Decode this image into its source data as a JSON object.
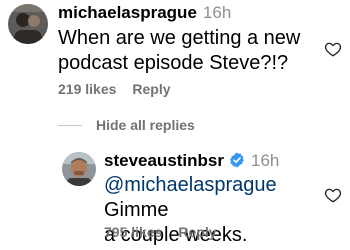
{
  "comment": {
    "username": "michaelasprague",
    "time": "16h",
    "text": "When are we getting a new podcast episode Steve?!?",
    "likes": "219 likes",
    "reply_label": "Reply"
  },
  "replies_toggle": {
    "label": "Hide all replies"
  },
  "reply": {
    "username": "steveaustinbsr",
    "verified": true,
    "time": "16h",
    "mention": "@michaelasprague",
    "text_line1": " Gimme",
    "text_line2": "a couple weeks.",
    "likes": "795 likes",
    "reply_label": "Reply"
  },
  "colors": {
    "verified_badge": "#3797f0",
    "meta_gray": "#737373",
    "mention_blue": "#00376b"
  },
  "icons": [
    "avatar",
    "verified-badge-icon",
    "heart-icon"
  ]
}
